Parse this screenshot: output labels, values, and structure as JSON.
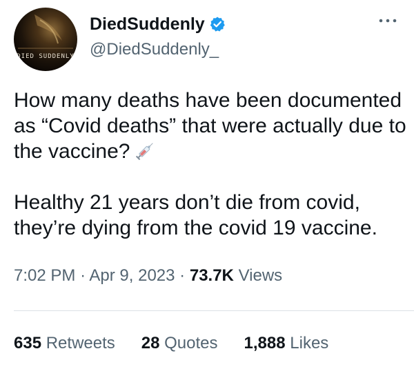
{
  "author": {
    "display_name": "DiedSuddenly",
    "handle": "@DiedSuddenly_",
    "verified": true,
    "avatar_text": "DIED SUDDENLY"
  },
  "tweet": {
    "paragraph1": "How many deaths have been documented as “Covid deaths” that were actually due to the vaccine?",
    "paragraph2": "Healthy 21 years don’t die from covid, they’re dying from the covid 19 vaccine.",
    "emoji": "syringe-icon"
  },
  "meta": {
    "time": "7:02 PM",
    "separator": "·",
    "date": "Apr 9, 2023",
    "views_count": "73.7K",
    "views_label": "Views"
  },
  "stats": {
    "retweets_count": "635",
    "retweets_label": "Retweets",
    "quotes_count": "28",
    "quotes_label": "Quotes",
    "likes_count": "1,888",
    "likes_label": "Likes"
  },
  "colors": {
    "text_primary": "#0f1419",
    "text_secondary": "#536471",
    "verified_blue": "#1d9bf0",
    "divider": "#dbe1e6"
  },
  "icons": {
    "verified": "verified-badge-icon",
    "more": "more-options-icon"
  }
}
